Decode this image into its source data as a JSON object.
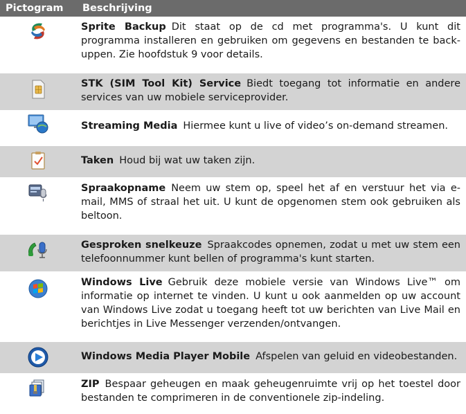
{
  "header": {
    "col_icon": "Pictogram",
    "col_desc": "Beschrijving"
  },
  "rows": [
    {
      "icon": "sprite-backup-icon",
      "name": "Sprite Backup",
      "text": "Dit staat op de cd met programma's. U kunt dit programma installeren en gebruiken om gegevens en bestanden te back-uppen. Zie hoofdstuk 9 voor details."
    },
    {
      "icon": "sim-card-icon",
      "name": "STK (SIM Tool Kit) Service",
      "text": "Biedt toegang tot informatie en andere services van uw mobiele serviceprovider."
    },
    {
      "icon": "streaming-media-icon",
      "name": "Streaming Media",
      "text": "Hiermee kunt u live of video’s on-demand streamen."
    },
    {
      "icon": "tasks-icon",
      "name": "Taken",
      "text": "Houd bij wat uw taken zijn."
    },
    {
      "icon": "voice-recorder-icon",
      "name": "Spraakopname",
      "text": "Neem uw stem op, speel het af en verstuur het via e-mail, MMS of straal het uit. U kunt de opgenomen stem ook gebruiken als beltoon."
    },
    {
      "icon": "voice-speed-dial-icon",
      "name": "Gesproken snelkeuze",
      "text": "Spraakcodes opnemen, zodat u met uw stem een telefoonnummer kunt bellen of programma's kunt starten."
    },
    {
      "icon": "windows-live-icon",
      "name": "Windows Live",
      "text": "Gebruik deze mobiele versie van Windows Live™ om informatie op internet te vinden. U kunt u ook aanmelden op uw account van Windows Live zodat u toegang heeft tot uw berichten van Live Mail en berichtjes in Live Messenger verzenden/ontvangen."
    },
    {
      "icon": "media-player-icon",
      "name": "Windows Media Player Mobile",
      "text": "Afspelen van geluid en videobestanden."
    },
    {
      "icon": "zip-icon",
      "name": "ZIP",
      "text": "Bespaar geheugen en maak geheugenruimte vrij op het toestel door bestanden te comprimeren in de conventionele zip-indeling."
    }
  ]
}
